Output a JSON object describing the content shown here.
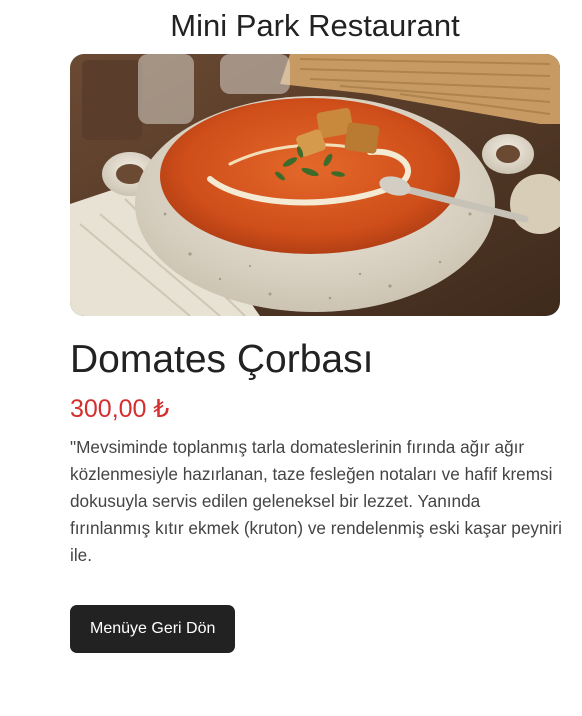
{
  "header": {
    "restaurant_name": "Mini Park Restaurant"
  },
  "dish": {
    "image_icon": "tomato-soup-photo",
    "title": "Domates Çorbası",
    "price": "300,00 ₺",
    "description": "\"Mevsiminde toplanmış tarla domateslerinin fırında ağır ağır közlenmesiyle hazırlanan, taze fesleğen notaları ve hafif kremsi dokusuyla servis edilen geleneksel bir lezzet. Yanında fırınlanmış kıtır ekmek (kruton) ve rendelenmiş eski kaşar peyniri ile."
  },
  "actions": {
    "back_label": "Menüye Geri Dön"
  },
  "colors": {
    "price": "#d32f2f",
    "button_bg": "#222222",
    "button_text": "#ffffff",
    "soup": "#d2551e"
  }
}
